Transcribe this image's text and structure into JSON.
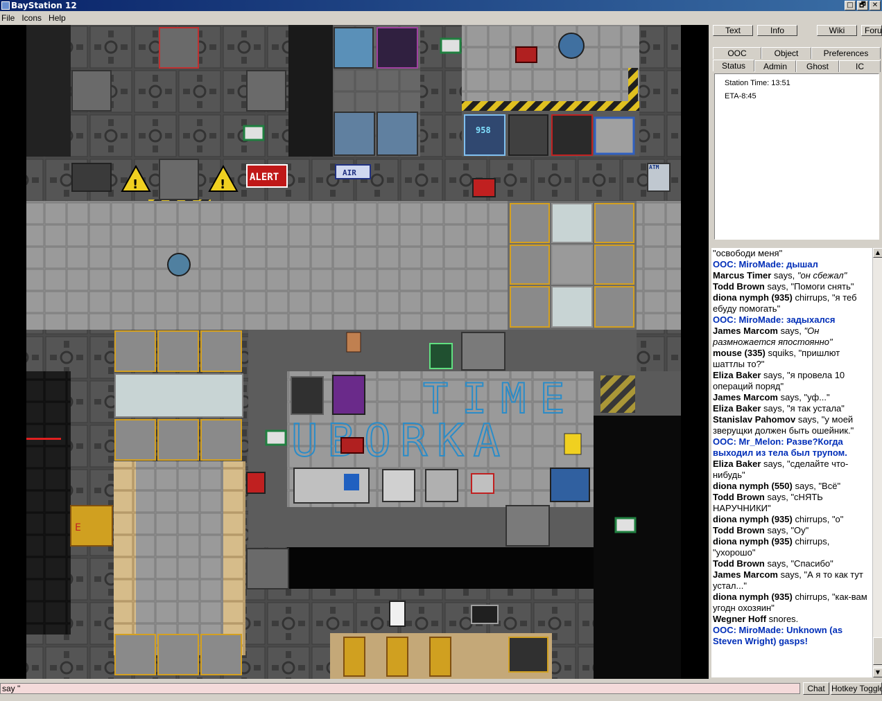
{
  "window": {
    "title": "BayStation 12",
    "controls": [
      "□",
      "🗗",
      "✕"
    ]
  },
  "menu": [
    "File",
    "Icons",
    "Help"
  ],
  "top_buttons": [
    "Text",
    "Info",
    "Wiki",
    "Forum"
  ],
  "tabs_row1": [
    "OOC",
    "Object",
    "Preferences"
  ],
  "tabs_row2": [
    "Status",
    "Admin",
    "Ghost",
    "IC"
  ],
  "status": {
    "station_time": "Station Time: 13:51",
    "eta": "ETA-8:45"
  },
  "game_text": {
    "alert": "ALERT",
    "air": "AIR",
    "atm": "ATM",
    "vend": "958",
    "floor_word1": "TIME",
    "floor_word2": "UBORKA",
    "door_letter": "E"
  },
  "chat": [
    {
      "type": "plain",
      "text": "\"освободи меня\""
    },
    {
      "type": "ooc",
      "text": "OOC: MiroMade: дышал"
    },
    {
      "type": "say",
      "name": "Marcus Timer",
      "verb": " says, ",
      "msg": "\"он сбежал\"",
      "italic": true
    },
    {
      "type": "say",
      "name": "Todd Brown",
      "verb": " says, ",
      "msg": "\"Помоги снять\""
    },
    {
      "type": "say",
      "name": "diona nymph (935)",
      "verb": " chirrups, ",
      "msg": "\"я теб ебуду помогать\""
    },
    {
      "type": "ooc",
      "text": "OOC: MiroMade: задыхался"
    },
    {
      "type": "say",
      "name": "James Marcom",
      "verb": " says, ",
      "msg": "\"Он размножается япостоянно\"",
      "italic": true
    },
    {
      "type": "say",
      "name": "mouse (335)",
      "verb": " squiks, ",
      "msg": "\"пришлют шаттлы то?\""
    },
    {
      "type": "say",
      "name": "Eliza Baker",
      "verb": " says, ",
      "msg": "\"я провела 10 операций поряд\""
    },
    {
      "type": "say",
      "name": "James Marcom",
      "verb": " says, ",
      "msg": "\"уф...\""
    },
    {
      "type": "say",
      "name": "Eliza Baker",
      "verb": " says, ",
      "msg": "\"я так устала\""
    },
    {
      "type": "say",
      "name": "Stanislav Pahomov",
      "verb": " says, ",
      "msg": "\"у моей зверущки должен быть ошейник.\""
    },
    {
      "type": "ooc",
      "text": "OOC: Mr_Melon: Разве?Когда выходил из тела был трупом."
    },
    {
      "type": "say",
      "name": "Eliza Baker",
      "verb": " says, ",
      "msg": "\"сделайте что-нибудь\""
    },
    {
      "type": "say",
      "name": "diona nymph (550)",
      "verb": " says, ",
      "msg": "\"Всё\""
    },
    {
      "type": "say",
      "name": "Todd Brown",
      "verb": " says, ",
      "msg": "\"сНЯТЬ НАРУЧНИКИ\""
    },
    {
      "type": "say",
      "name": "diona nymph (935)",
      "verb": " chirrups, ",
      "msg": "\"о\""
    },
    {
      "type": "say",
      "name": "Todd Brown",
      "verb": " says, ",
      "msg": "\"Оу\""
    },
    {
      "type": "say",
      "name": "diona nymph (935)",
      "verb": " chirrups, ",
      "msg": "\"ухорошо\""
    },
    {
      "type": "say",
      "name": "Todd Brown",
      "verb": " says, ",
      "msg": "\"Спасибо\""
    },
    {
      "type": "say",
      "name": "James Marcom",
      "verb": " says, ",
      "msg": "\"А я то как тут устал...\""
    },
    {
      "type": "say",
      "name": "diona nymph (935)",
      "verb": " chirrups, ",
      "msg": "\"как-вам угодн охозяин\""
    },
    {
      "type": "say",
      "name": "Wegner Hoff",
      "verb": " snores.",
      "msg": ""
    },
    {
      "type": "ooc",
      "text": "OOC: MiroMade: Unknown (as Steven Wright) gasps!"
    }
  ],
  "input": {
    "value": "say \""
  },
  "bottom_buttons": [
    "Chat",
    "Hotkey Toggle"
  ],
  "colors": {
    "ooc": "#002eb8",
    "floor": "#8c8c8c",
    "wall": "#3a3a3a",
    "input_bg": "#f4dada"
  }
}
